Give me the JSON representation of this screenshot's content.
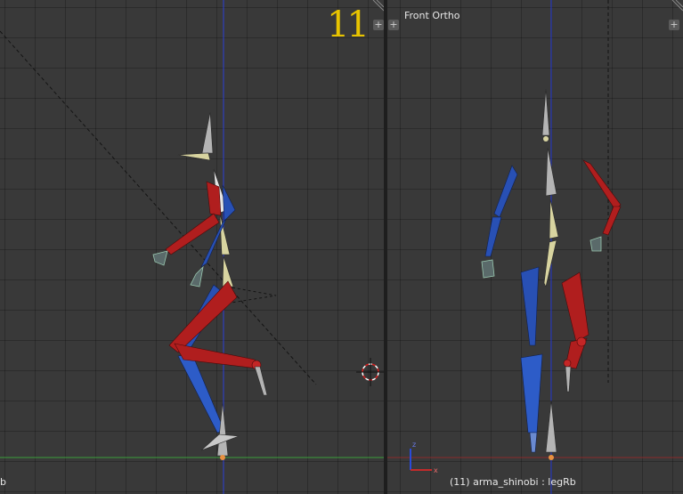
{
  "left_viewport": {
    "frame_number": "11",
    "status_text": "b"
  },
  "right_viewport": {
    "view_name": "Front Ortho",
    "status_text": "(11) arma_shinobi : legRb"
  },
  "buttons": {
    "area_plus": "+"
  },
  "colors": {
    "grid_background": "#393939",
    "bone_red": "#b01e1e",
    "bone_blue": "#2850b4",
    "bone_grey": "#b4b4b4",
    "bone_yellow": "#d8d4a0",
    "frame_number": "#e8c400",
    "z_axis": "#2a4bd8",
    "x_axis_red": "#8a2a2a",
    "y_axis_green": "#3aa03a"
  }
}
